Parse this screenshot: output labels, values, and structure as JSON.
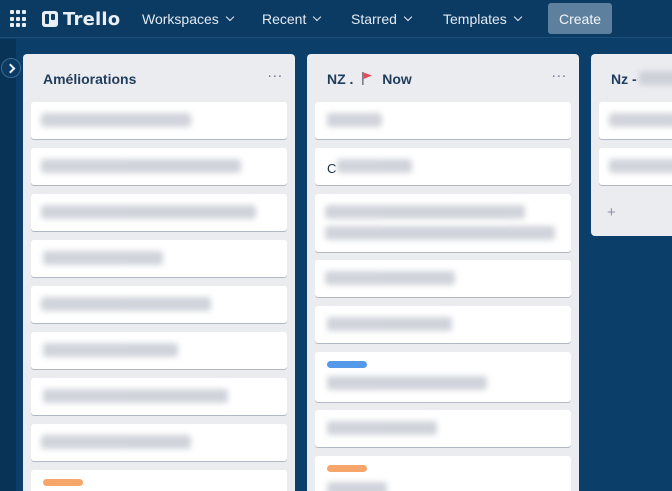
{
  "header": {
    "brand": "Trello",
    "nav": [
      {
        "label": "Workspaces"
      },
      {
        "label": "Recent"
      },
      {
        "label": "Starred"
      },
      {
        "label": "Templates"
      }
    ],
    "create_label": "Create"
  },
  "lists": [
    {
      "title": "Améliorations",
      "menu": "···"
    },
    {
      "title_prefix": "NZ .",
      "title_suffix": "Now",
      "menu": "···",
      "card_text_c": "C"
    },
    {
      "title": "Nz -",
      "add_card": "+"
    }
  ],
  "colors": {
    "board_bg": "#0b3f6a",
    "list_bg": "#ebecf0",
    "label_orange": "#f6a66b",
    "label_blue": "#5599e8",
    "flag_red": "#e34b5b"
  }
}
